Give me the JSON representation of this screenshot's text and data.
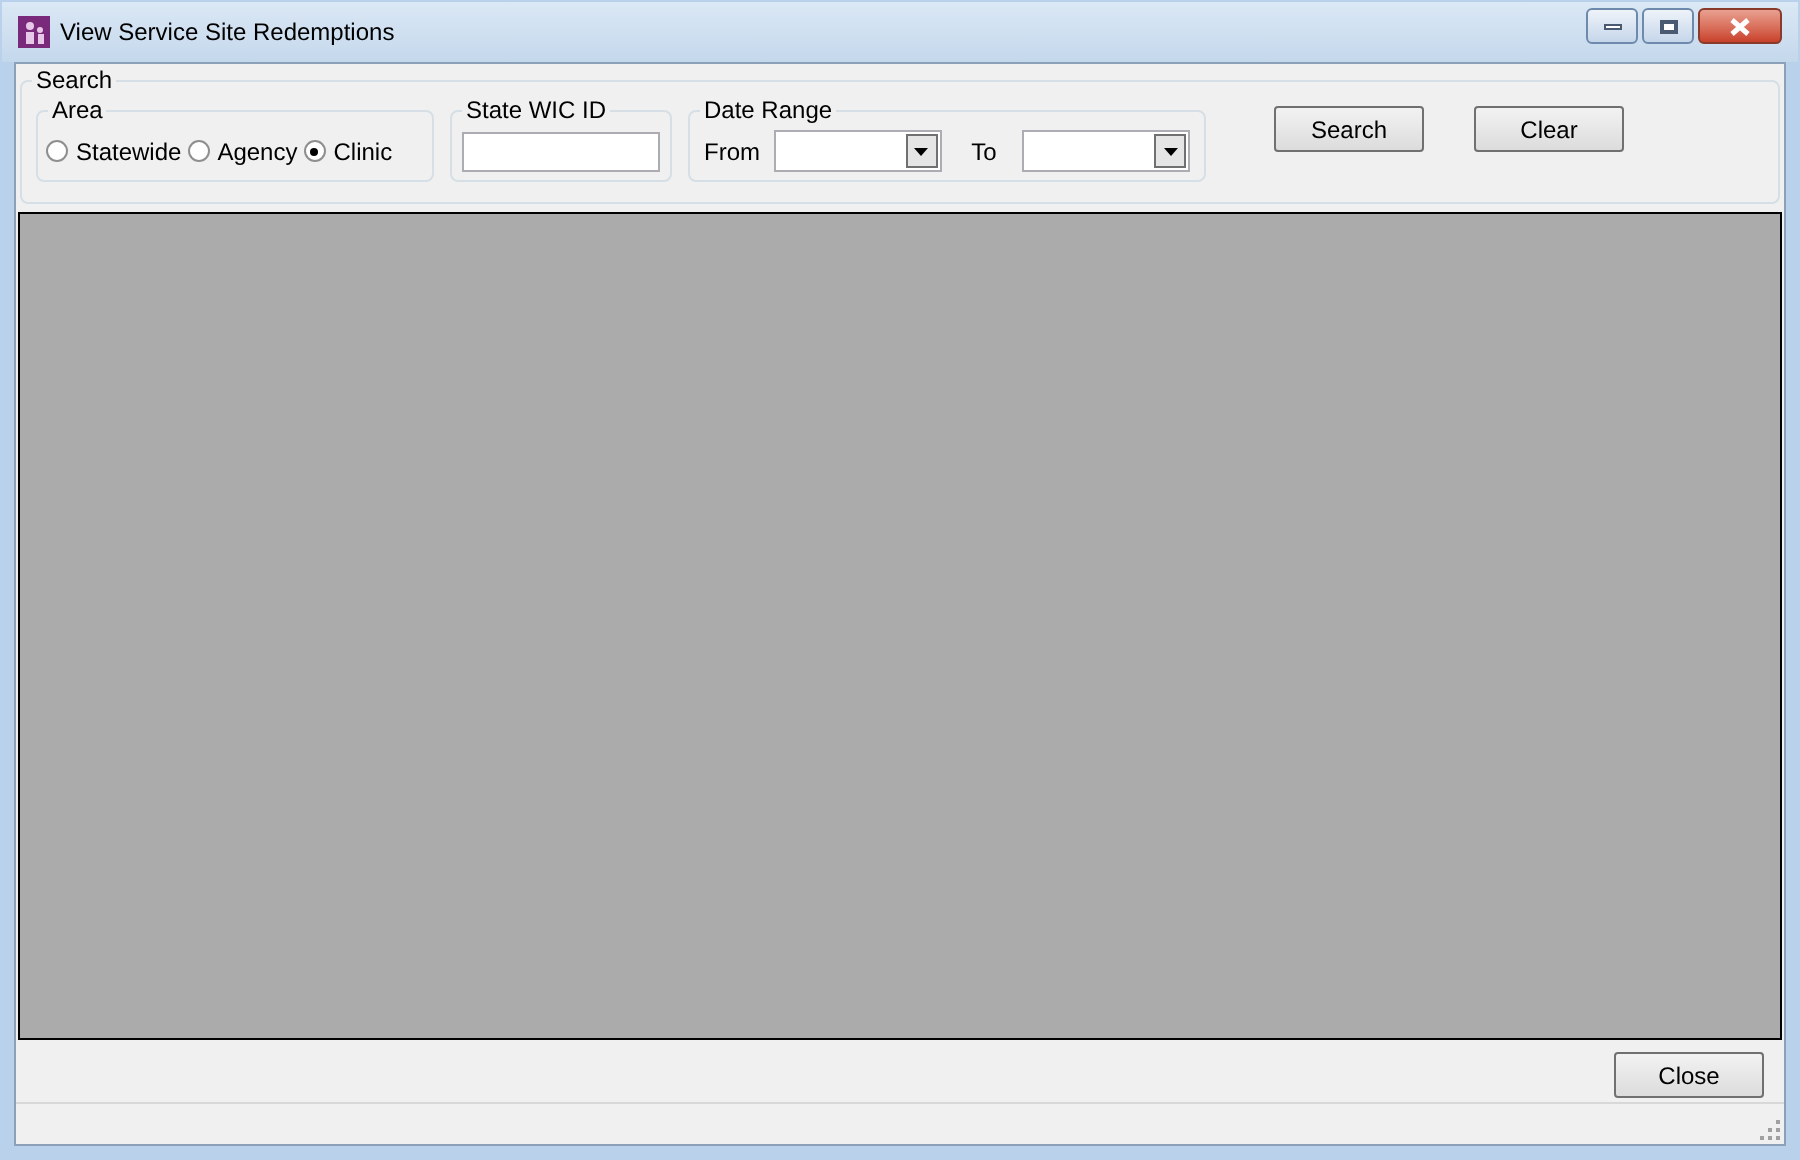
{
  "window": {
    "title": "View Service Site Redemptions"
  },
  "search": {
    "title": "Search",
    "area": {
      "title": "Area",
      "options": [
        {
          "label": "Statewide",
          "selected": false
        },
        {
          "label": "Agency",
          "selected": false
        },
        {
          "label": "Clinic",
          "selected": true
        }
      ]
    },
    "state_wic_id": {
      "title": "State WIC ID"
    },
    "date_range": {
      "title": "Date Range",
      "from_label": "From",
      "to_label": "To"
    },
    "buttons": [
      "Search",
      "Clear"
    ]
  },
  "footer": {
    "buttons": [
      "Close"
    ]
  }
}
